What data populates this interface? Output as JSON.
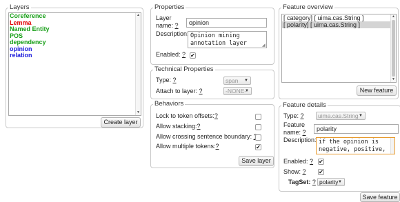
{
  "layers": {
    "legend": "Layers",
    "items": [
      {
        "label": "Coreference",
        "color": "#169e16"
      },
      {
        "label": "Lemma",
        "color": "#e00000"
      },
      {
        "label": "Named Entity",
        "color": "#169e16"
      },
      {
        "label": "POS",
        "color": "#169e16"
      },
      {
        "label": "dependency",
        "color": "#169e16"
      },
      {
        "label": "opinion",
        "color": "#1a1adb"
      },
      {
        "label": "relation",
        "color": "#1a1adb"
      }
    ],
    "create_button": "Create layer"
  },
  "properties": {
    "legend": "Properties",
    "layer_name_label": "Layer",
    "layer_name_label2": "name:",
    "layer_name_value": "opinion",
    "description_label": "Description:",
    "description_value": "Opinion mining annotation layer",
    "enabled_label": "Enabled:",
    "help": "?",
    "check": "✔"
  },
  "technical": {
    "legend": "Technical Properties",
    "type_label": "Type:",
    "type_value": "span",
    "attach_label": "Attach to layer:",
    "attach_value": "-NONE-"
  },
  "behaviors": {
    "legend": "Behaviors",
    "lock_label": "Lock to token offsets:",
    "stacking_label": "Allow stacking:",
    "crossing_label": "Allow crossing sentence boundary:",
    "multiple_label": "Allow multiple tokens:",
    "save_button": "Save layer"
  },
  "feature_overview": {
    "legend": "Feature overview",
    "items": [
      "[ category] [ uima.cas.String ]",
      "[ polarity] [ uima.cas.String ]"
    ],
    "new_button": "New feature"
  },
  "feature_details": {
    "legend": "Feature details",
    "type_label": "Type:",
    "type_value": "uima.cas.String",
    "name_label": "Feature",
    "name_label2": "name:",
    "name_value": "polarity",
    "description_label": "Description:",
    "description_value": "if the opinion is negative, positive,",
    "enabled_label": "Enabled:",
    "show_label": "Show:",
    "tagset_label": "TagSet:",
    "tagset_value": "polarity",
    "save_button": "Save feature"
  },
  "icons": {
    "scroll_up": "▲",
    "scroll_down": "▼",
    "select_arrow": "▼",
    "resize_grip": "◢"
  }
}
